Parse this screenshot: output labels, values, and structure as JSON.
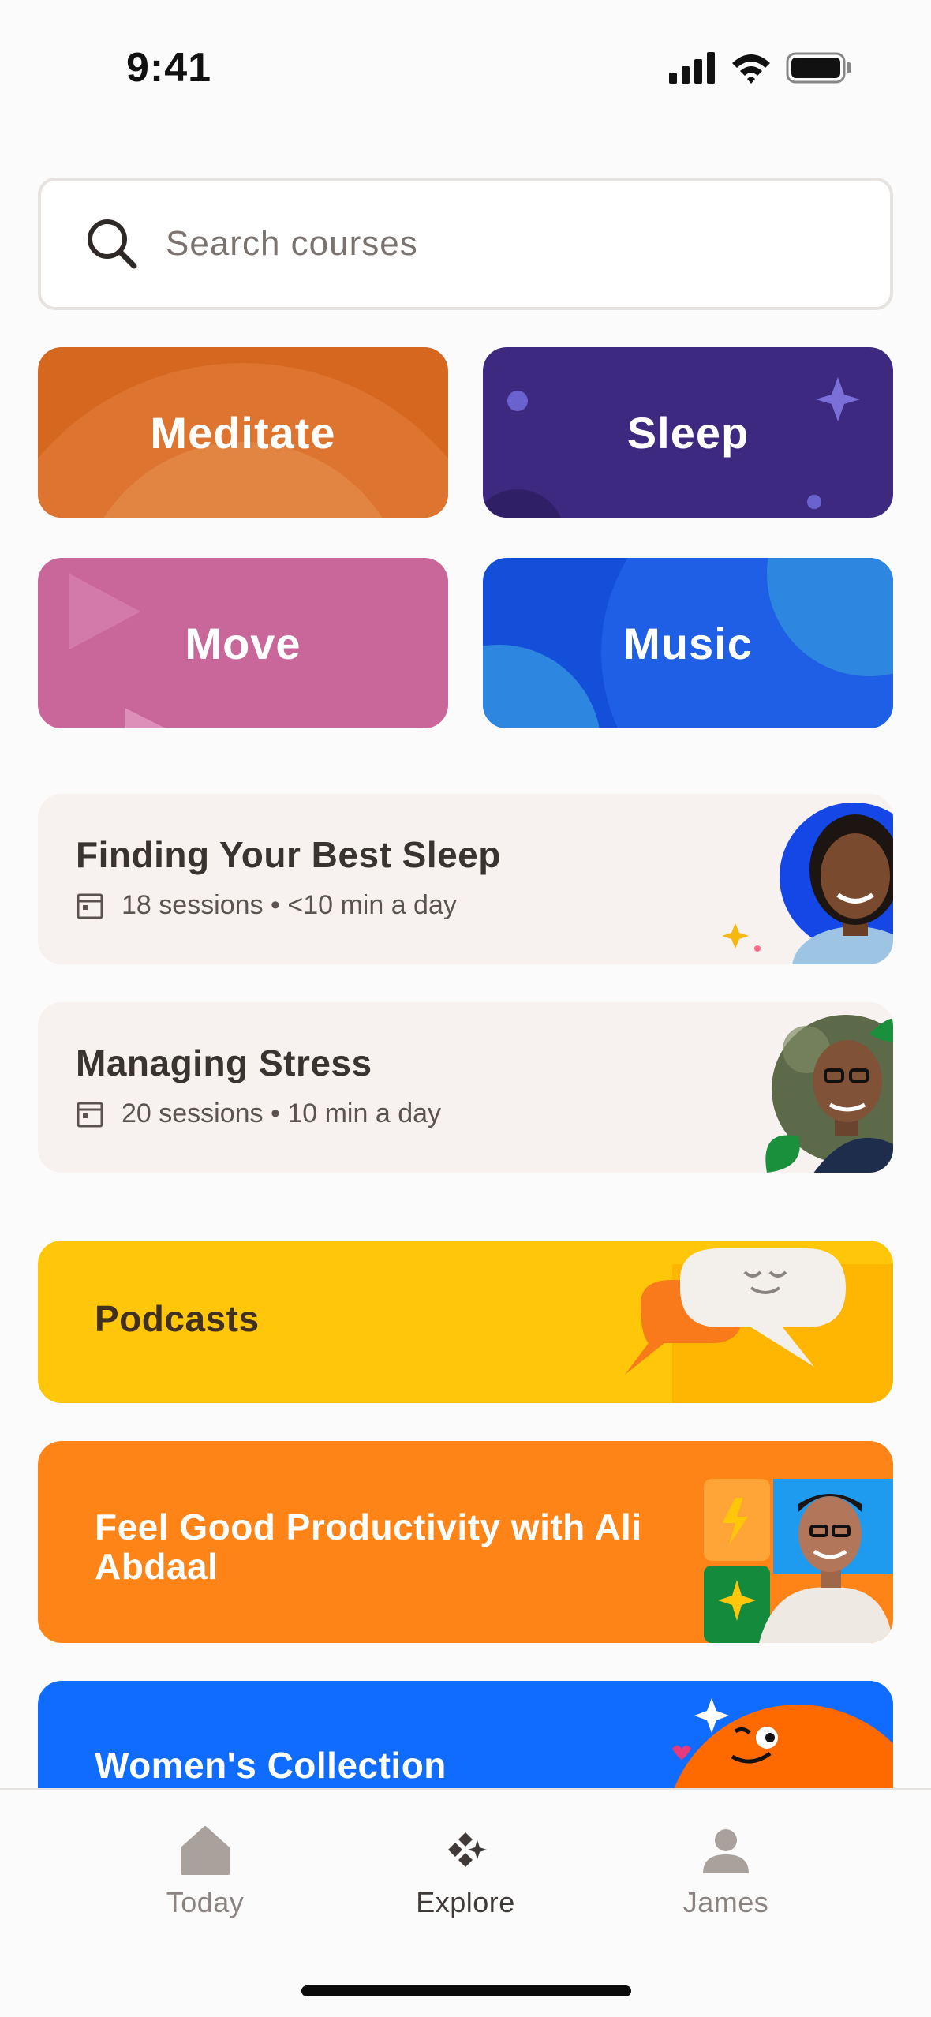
{
  "status_bar": {
    "time": "9:41",
    "icons": [
      "signal-icon",
      "wifi-icon",
      "battery-icon"
    ]
  },
  "search": {
    "placeholder": "Search courses",
    "icon": "search-icon"
  },
  "categories": [
    {
      "label": "Meditate",
      "color": "#d6671f"
    },
    {
      "label": "Sleep",
      "color": "#3d2a80"
    },
    {
      "label": "Move",
      "color": "#c9679b"
    },
    {
      "label": "Music",
      "color": "#134fd9"
    }
  ],
  "courses": [
    {
      "title": "Finding Your Best Sleep",
      "meta": "18 sessions • <10 min a day",
      "icon": "calendar-icon"
    },
    {
      "title": "Managing Stress",
      "meta": "20 sessions • 10 min a day",
      "icon": "calendar-icon"
    }
  ],
  "banners": {
    "podcasts": {
      "label": "Podcasts",
      "color": "#ffc60a"
    },
    "productivity": {
      "label": "Feel Good Productivity with Ali Abdaal",
      "color": "#ff8418"
    },
    "women": {
      "label": "Women's Collection",
      "color": "#0f6cff"
    }
  },
  "tabbar": {
    "tabs": [
      {
        "label": "Today",
        "icon": "home-icon",
        "active": false
      },
      {
        "label": "Explore",
        "icon": "explore-icon",
        "active": true
      },
      {
        "label": "James",
        "icon": "profile-icon",
        "active": false
      }
    ]
  }
}
